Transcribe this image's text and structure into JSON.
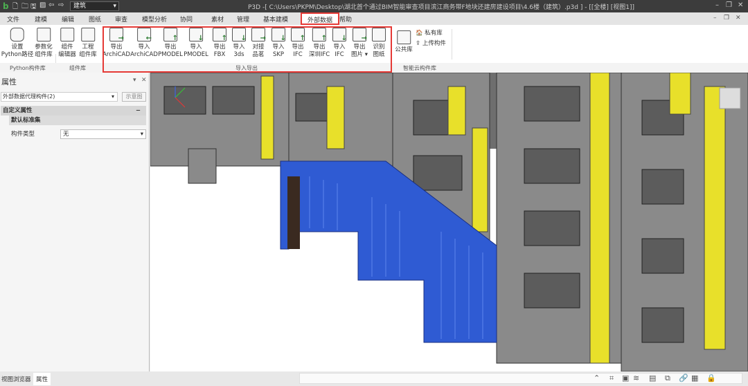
{
  "titlebar": {
    "view_combo": "建筑",
    "title": "P3D -[ C:\\Users\\PKPM\\Desktop\\湖北首个通过BIM智能审查项目滨江商务带F地块还建房建设项目\\4.6楼（建筑）.p3d ] - [[全楼] [视图1]]"
  },
  "menu": [
    "文件",
    "建模",
    "编辑",
    "图纸",
    "审查",
    "模型分析",
    "协同",
    "素材",
    "管理",
    "基本建模",
    "外部数据",
    "帮助"
  ],
  "active_menu": "外部数据",
  "ribbon": {
    "python": [
      {
        "l1": "设置",
        "l2": "Python路径"
      },
      {
        "l1": "参数化",
        "l2": "组件库"
      }
    ],
    "component": [
      {
        "l1": "组件",
        "l2": "编辑器"
      },
      {
        "l1": "工程",
        "l2": "组件库"
      }
    ],
    "io": [
      {
        "l1": "导出",
        "l2": "ArchiCAD"
      },
      {
        "l1": "导入",
        "l2": "ArchiCAD"
      },
      {
        "l1": "导出",
        "l2": "PMODEL"
      },
      {
        "l1": "导入",
        "l2": "PMODEL"
      },
      {
        "l1": "导出",
        "l2": "FBX"
      },
      {
        "l1": "导入",
        "l2": "3ds"
      },
      {
        "l1": "对接",
        "l2": "品茗"
      },
      {
        "l1": "导入",
        "l2": "SKP"
      },
      {
        "l1": "导出",
        "l2": "IFC"
      },
      {
        "l1": "导出",
        "l2": "深圳IFC"
      },
      {
        "l1": "导入",
        "l2": "IFC"
      },
      {
        "l1": "导出",
        "l2": "图片 ▾"
      },
      {
        "l1": "识别",
        "l2": "图纸"
      }
    ],
    "cloud": {
      "public": "公共库",
      "private": "私有库",
      "upload": "上传构件"
    },
    "groups": {
      "python": "Python构件库",
      "component": "组件库",
      "io": "导入导出",
      "cloud": "智能云构件库"
    }
  },
  "panel": {
    "title": "属性",
    "selector": "外部数据代理构件(2)",
    "diagram_button": "示意图",
    "section": "自定义属性",
    "subsection": "默认标准集",
    "prop_label": "构件类型",
    "prop_value": "无"
  },
  "status": {
    "tabs": [
      "视图浏览器",
      "属性"
    ],
    "active_tab": "属性"
  }
}
